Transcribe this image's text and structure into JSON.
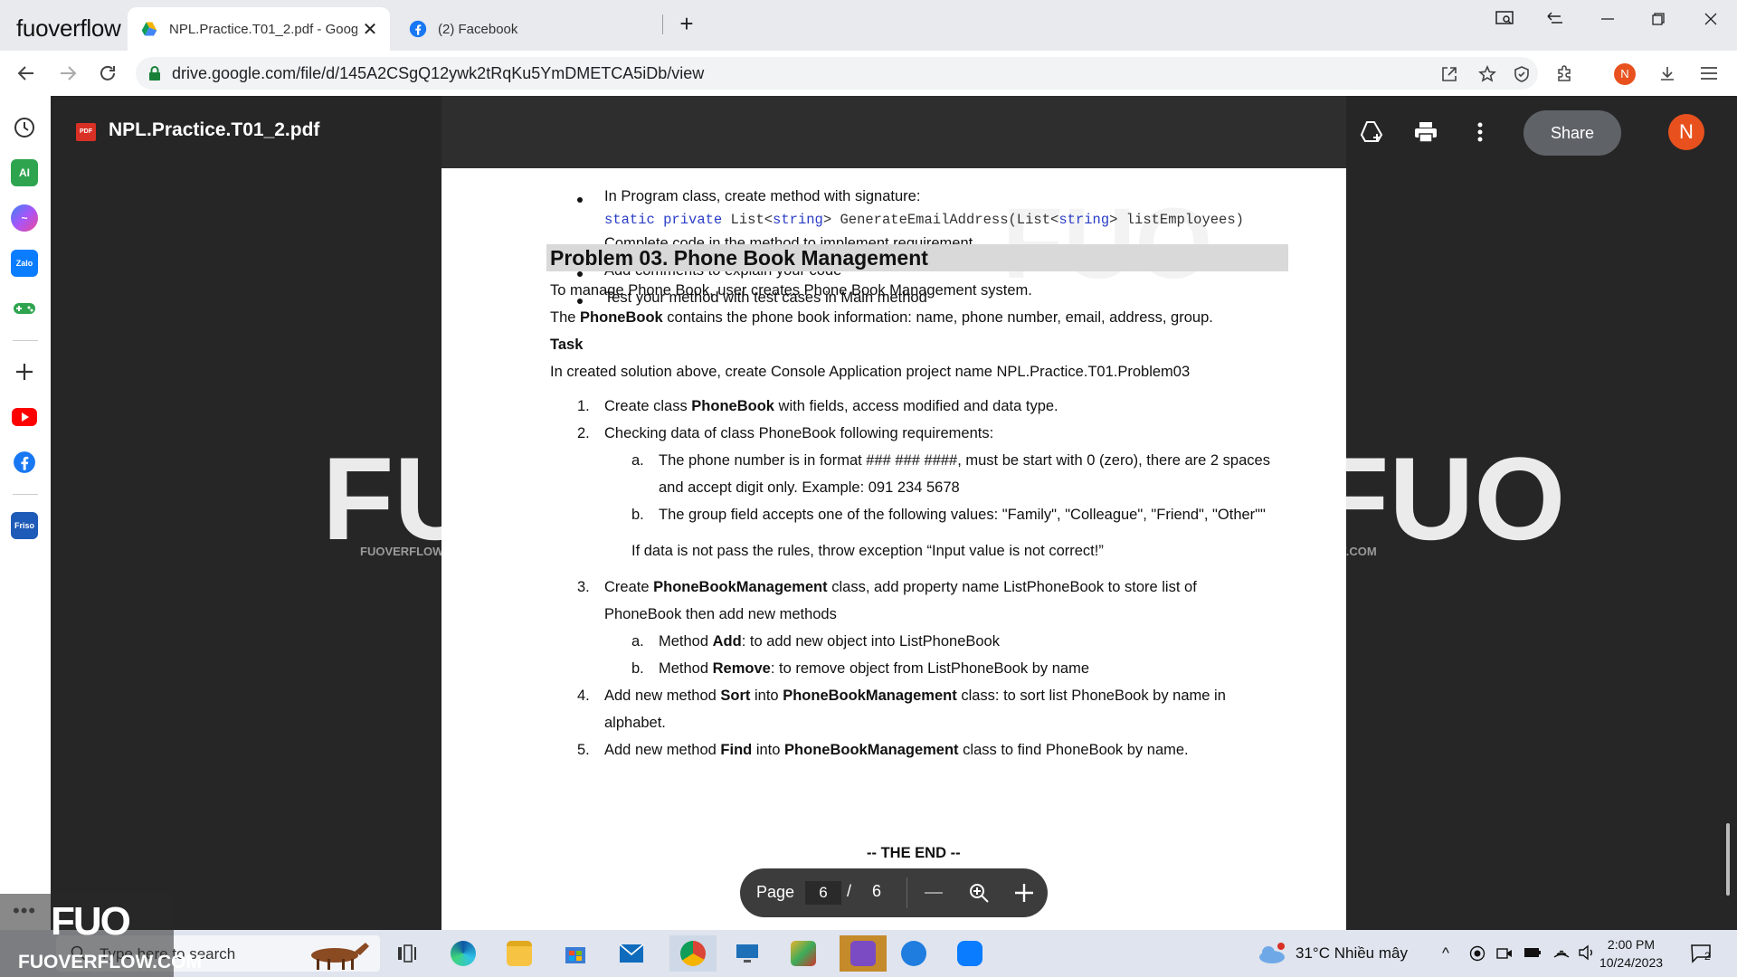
{
  "browser": {
    "brand": "fuoverflow",
    "tabs": [
      {
        "title": "NPL.Practice.T01_2.pdf - Google",
        "close": "✕"
      },
      {
        "title": "(2) Facebook"
      }
    ],
    "url": "drive.google.com/file/d/145A2CSgQ12ywk2tRqKu5YmDMETCA5iDb/view",
    "profile_initial": "N"
  },
  "viewer": {
    "file_name": "NPL.Practice.T01_2.pdf",
    "share_label": "Share",
    "avatar_initial": "N",
    "pdf_badge": "PDF"
  },
  "document": {
    "top_bullets": [
      "In Program class, create method with signature:",
      "Complete code in the method to implement requirement",
      "Add comments to explain your code",
      "Test your method with test cases in Main method"
    ],
    "signature": {
      "kw1": "static private",
      "t1": " List<",
      "kw2": "string",
      "t2": "> GenerateEmailAddress(List<",
      "kw3": "string",
      "t3": "> listEmployees)"
    },
    "heading": "Problem 03. Phone Book Management",
    "intro": "To manage Phone Book, user creates Phone Book Management system.",
    "phonebook_line": {
      "pre": "The ",
      "bold": "PhoneBook",
      "post": " contains the phone book information: name, phone number, email, address, group."
    },
    "task_label": "Task",
    "task_line": "In created solution above, create Console Application project name NPL.Practice.T01.Problem03",
    "items": {
      "i1": {
        "num": "1.",
        "pre": "Create class ",
        "bold": "PhoneBook",
        "post": " with fields, access modified and data type."
      },
      "i2": {
        "num": "2.",
        "text": "Checking data of class PhoneBook following requirements:"
      },
      "i2a": {
        "num": "a.",
        "line1": "The phone number is in format ### ### ####, must be start with 0 (zero), there are 2 spaces",
        "line2": "and accept digit only. Example: 091 234 5678"
      },
      "i2b": {
        "num": "b.",
        "text": "The group field accepts one of the following values: \"Family\", \"Colleague\", \"Friend\", \"Other\"\""
      },
      "i2note": "If data is not pass the rules, throw exception “Input value is not correct!”",
      "i3": {
        "num": "3.",
        "pre": "Create ",
        "bold": "PhoneBookManagement",
        "post": " class, add property name ListPhoneBook to store list of",
        "line2": "PhoneBook then add new methods"
      },
      "i3a": {
        "num": "a.",
        "pre": "Method ",
        "bold": "Add",
        "post": ": to add new object into ListPhoneBook"
      },
      "i3b": {
        "num": "b.",
        "pre": "Method ",
        "bold": "Remove",
        "post": ": to remove object from ListPhoneBook by name"
      },
      "i4": {
        "num": "4.",
        "pre": "Add new method ",
        "bold": "Sort",
        "mid": " into ",
        "bold2": "PhoneBookManagement",
        "post": " class: to sort list PhoneBook by name in",
        "line2": "alphabet."
      },
      "i5": {
        "num": "5.",
        "pre": "Add new method ",
        "bold": "Find",
        "mid": " into ",
        "bold2": "PhoneBookManagement",
        "post": " class to find PhoneBook by name."
      }
    },
    "the_end": "-- THE END --",
    "watermark_small": "FUOVERFLOW.COM",
    "watermark_big": "FUO"
  },
  "pager": {
    "label": "Page",
    "current": "6",
    "sep": "/",
    "total": "6"
  },
  "taskbar": {
    "search_placeholder": "Type here to search",
    "weather": "31°C  Nhiều mây",
    "time": "2:00 PM",
    "date": "10/24/2023",
    "notif_count": "2"
  },
  "overlay_logo": {
    "big": "FUO",
    "small": "FUOVERFLOW.COM"
  },
  "colors": {
    "accent": "#e8511e",
    "viewer_bg": "#262626",
    "code_keyword": "#2a3dc6"
  }
}
